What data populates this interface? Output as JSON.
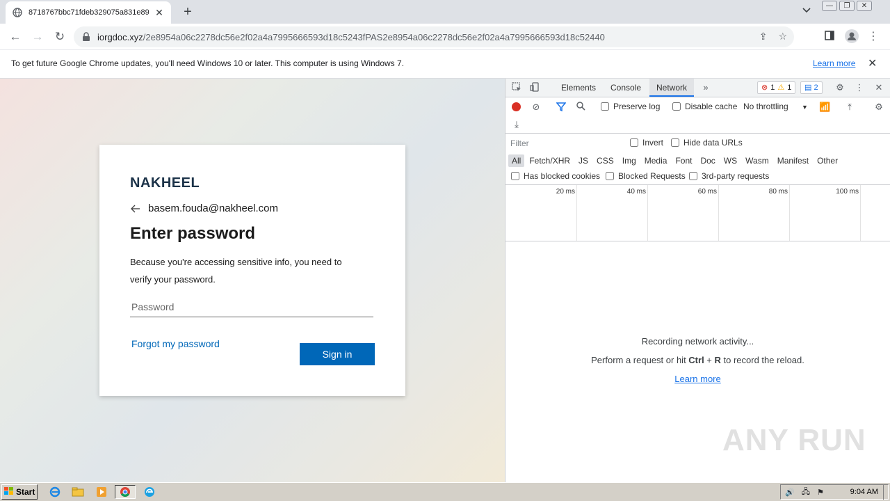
{
  "browser": {
    "tab_title": "8718767bbc71fdeb329075a831e89...",
    "url_host": "iorgdoc.xyz",
    "url_path": "/2e8954a06c2278dc56e2f02a4a7995666593d18c5243fPAS2e8954a06c2278dc56e2f02a4a7995666593d18c52440"
  },
  "infobar": {
    "message": "To get future Google Chrome updates, you'll need Windows 10 or later. This computer is using Windows 7.",
    "learn_more": "Learn more"
  },
  "login": {
    "brand": "NAKHEEL",
    "email": "basem.fouda@nakheel.com",
    "heading": "Enter password",
    "description": "Because you're accessing sensitive info, you need to verify your password.",
    "password_placeholder": "Password",
    "forgot": "Forgot my password",
    "signin": "Sign in"
  },
  "devtools": {
    "tabs": [
      "Elements",
      "Console",
      "Network"
    ],
    "active_tab": "Network",
    "errors": "1",
    "warnings": "1",
    "messages": "2",
    "preserve_log": "Preserve log",
    "disable_cache": "Disable cache",
    "throttling": "No throttling",
    "filter_placeholder": "Filter",
    "invert": "Invert",
    "hide_data_urls": "Hide data URLs",
    "types": [
      "All",
      "Fetch/XHR",
      "JS",
      "CSS",
      "Img",
      "Media",
      "Font",
      "Doc",
      "WS",
      "Wasm",
      "Manifest",
      "Other"
    ],
    "has_blocked_cookies": "Has blocked cookies",
    "blocked_requests": "Blocked Requests",
    "third_party": "3rd-party requests",
    "ticks": [
      "20 ms",
      "40 ms",
      "60 ms",
      "80 ms",
      "100 ms"
    ],
    "empty_line1": "Recording network activity...",
    "empty_line2_pre": "Perform a request or hit ",
    "empty_line2_key1": "Ctrl",
    "empty_line2_plus": " + ",
    "empty_line2_key2": "R",
    "empty_line2_post": " to record the reload.",
    "empty_learn": "Learn more"
  },
  "watermark": "ANY RUN",
  "taskbar": {
    "start": "Start",
    "clock": "9:04 AM"
  },
  "colors": {
    "accent": "#0067b8",
    "record": "#d93025",
    "link": "#1a73e8"
  }
}
